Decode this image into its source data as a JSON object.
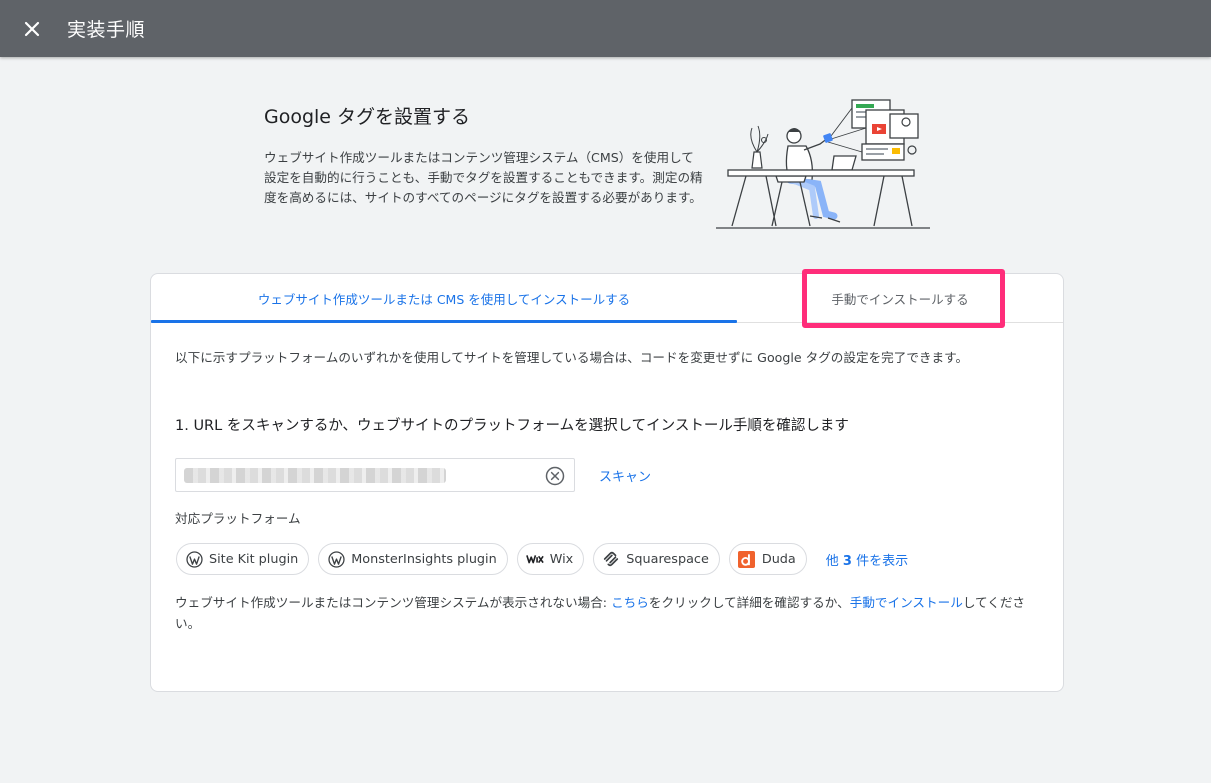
{
  "header": {
    "title": "実装手順",
    "close_icon": "close-icon"
  },
  "hero": {
    "title": "Google タグを設置する",
    "description": "ウェブサイト作成ツールまたはコンテンツ管理システム（CMS）を使用して設定を自動的に行うことも、手動でタグを設置することもできます。測定の精度を高めるには、サイトのすべてのページにタグを設置する必要があります。"
  },
  "tabs": [
    {
      "label": "ウェブサイト作成ツールまたは CMS を使用してインストールする",
      "active": true
    },
    {
      "label": "手動でインストールする",
      "active": false
    }
  ],
  "body": {
    "intro": "以下に示すプラットフォームのいずれかを使用してサイトを管理している場合は、コードを変更せずに Google タグの設定を完了できます。",
    "step_title": "1. URL をスキャンするか、ウェブサイトのプラットフォームを選択してインストール手順を確認します",
    "url_input": {
      "value": "",
      "placeholder": ""
    },
    "scan_label": "スキャン",
    "platforms_label": "対応プラットフォーム",
    "platforms": [
      {
        "label": "Site Kit plugin",
        "icon": "wordpress-icon"
      },
      {
        "label": "MonsterInsights plugin",
        "icon": "wordpress-icon"
      },
      {
        "label": "Wix",
        "icon": "wix-icon"
      },
      {
        "label": "Squarespace",
        "icon": "squarespace-icon"
      },
      {
        "label": "Duda",
        "icon": "duda-icon"
      }
    ],
    "more_prefix": "他 ",
    "more_count": "3",
    "more_suffix": " 件を表示",
    "footer": {
      "part1": "ウェブサイト作成ツールまたはコンテンツ管理システムが表示されない場合: ",
      "link1": "こちら",
      "part2": "をクリックして詳細を確認するか、",
      "link2": "手動でインストール",
      "part3": "してください。"
    }
  },
  "colors": {
    "accent": "#1a73e8",
    "header_bg": "#5f6368",
    "highlight": "#ff2d7a",
    "background": "#f1f3f4"
  }
}
